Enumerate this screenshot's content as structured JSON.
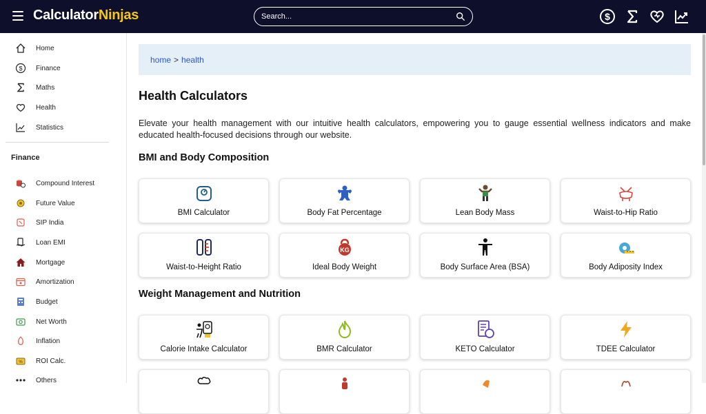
{
  "header": {
    "logo_part1": "Calculator",
    "logo_part2": "Ninjas",
    "search_placeholder": "Search...",
    "icons": [
      "dollar-icon",
      "sigma-icon",
      "heart-icon",
      "chart-icon"
    ]
  },
  "sidebar": {
    "nav": [
      {
        "label": "Home",
        "icon": "home-icon"
      },
      {
        "label": "Finance",
        "icon": "dollar-icon"
      },
      {
        "label": "Maths",
        "icon": "sigma-icon"
      },
      {
        "label": "Health",
        "icon": "heart-icon"
      },
      {
        "label": "Statistics",
        "icon": "chart-icon"
      }
    ],
    "section_heading": "Finance",
    "finance_items": [
      {
        "label": "Compound Interest",
        "icon": "coins-icon"
      },
      {
        "label": "Future Value",
        "icon": "future-value-icon"
      },
      {
        "label": "SIP India",
        "icon": "sip-icon"
      },
      {
        "label": "Loan EMI",
        "icon": "loan-icon"
      },
      {
        "label": "Mortgage",
        "icon": "house-icon"
      },
      {
        "label": "Amortization",
        "icon": "calendar-icon"
      },
      {
        "label": "Budget",
        "icon": "budget-icon"
      },
      {
        "label": "Net Worth",
        "icon": "net-worth-icon"
      },
      {
        "label": "Inflation",
        "icon": "inflation-icon"
      },
      {
        "label": "ROI Calc.",
        "icon": "roi-icon"
      },
      {
        "label": "Others",
        "icon": "more-icon"
      }
    ]
  },
  "breadcrumb": {
    "home": "home",
    "separator": ">",
    "current": "health"
  },
  "main": {
    "title": "Health Calculators",
    "intro": "Elevate your health management with our intuitive health calculators, empowering you to gauge essential wellness indicators and make educated health-focused decisions through our website.",
    "sections": [
      {
        "title": "BMI and Body Composition",
        "cards": [
          {
            "label": "BMI Calculator",
            "icon": "scale-icon"
          },
          {
            "label": "Body Fat Percentage",
            "icon": "body-fat-icon"
          },
          {
            "label": "Lean Body Mass",
            "icon": "muscle-person-icon"
          },
          {
            "label": "Waist-to-Hip Ratio",
            "icon": "waist-hip-icon"
          },
          {
            "label": "Waist-to-Height Ratio",
            "icon": "ruler-icon"
          },
          {
            "label": "Ideal Body Weight",
            "icon": "kettlebell-icon"
          },
          {
            "label": "Body Surface Area (BSA)",
            "icon": "person-icon"
          },
          {
            "label": "Body Adiposity Index",
            "icon": "measuring-tape-icon"
          }
        ]
      },
      {
        "title": "Weight Management and Nutrition",
        "cards": [
          {
            "label": "Calorie Intake Calculator",
            "icon": "calorie-icon"
          },
          {
            "label": "BMR Calculator",
            "icon": "flame-icon"
          },
          {
            "label": "KETO Calculator",
            "icon": "keto-icon"
          },
          {
            "label": "TDEE Calculator",
            "icon": "lightning-icon"
          }
        ]
      }
    ]
  },
  "colors": {
    "header_bg": "#0d0f2b",
    "logo_accent": "#f5c518",
    "breadcrumb_bg": "#e5eff7",
    "link": "#2c56d6"
  }
}
